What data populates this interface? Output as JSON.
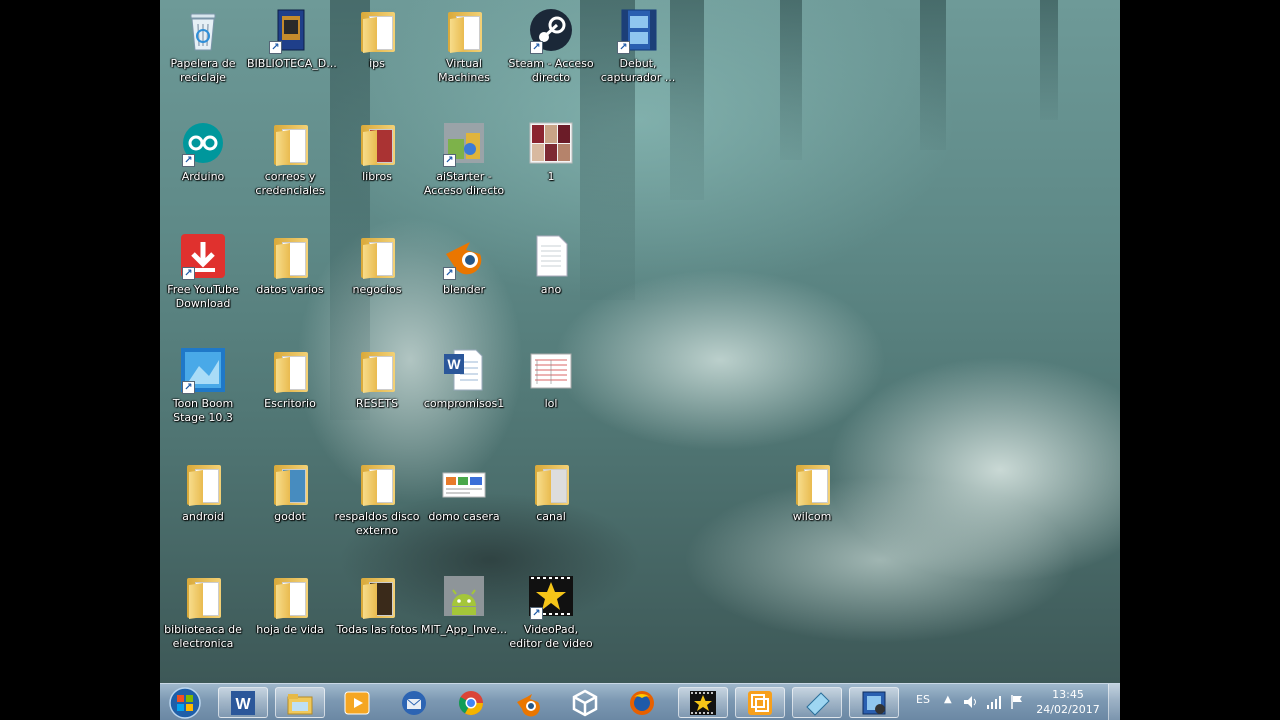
{
  "desktop": {
    "icons": [
      {
        "id": "recycle",
        "label": "Papelera de reciclaje"
      },
      {
        "id": "biblioteca",
        "label": "BIBLIOTECA_D..."
      },
      {
        "id": "ips",
        "label": "ips"
      },
      {
        "id": "vm",
        "label": "Virtual Machines"
      },
      {
        "id": "steam",
        "label": "Steam - Acceso directo"
      },
      {
        "id": "debut",
        "label": "Debut, capturador ..."
      },
      {
        "id": "arduino",
        "label": "Arduino"
      },
      {
        "id": "correos",
        "label": "correos y credenciales"
      },
      {
        "id": "libros",
        "label": "libros"
      },
      {
        "id": "aistarter",
        "label": "aiStarter - Acceso directo"
      },
      {
        "id": "one",
        "label": "1"
      },
      {
        "id": "fyd",
        "label": "Free YouTube Download"
      },
      {
        "id": "datos",
        "label": "datos varios"
      },
      {
        "id": "negocios",
        "label": "negocios"
      },
      {
        "id": "blender",
        "label": "blender"
      },
      {
        "id": "ano",
        "label": "ano"
      },
      {
        "id": "toonboom",
        "label": "Toon Boom Stage 10.3"
      },
      {
        "id": "escritorio",
        "label": "Escritorio"
      },
      {
        "id": "resets",
        "label": "RESETS"
      },
      {
        "id": "compromisos",
        "label": "compromisos1"
      },
      {
        "id": "lol",
        "label": "lol"
      },
      {
        "id": "android",
        "label": "android"
      },
      {
        "id": "godot",
        "label": "godot"
      },
      {
        "id": "respaldos",
        "label": "respaldos disco externo"
      },
      {
        "id": "domo",
        "label": "domo casera"
      },
      {
        "id": "canal",
        "label": "canal"
      },
      {
        "id": "wilcom",
        "label": "wilcom"
      },
      {
        "id": "bibelec",
        "label": "biblioteaca de electronica"
      },
      {
        "id": "hoja",
        "label": "hoja de vida"
      },
      {
        "id": "fotos",
        "label": "Todas las fotos"
      },
      {
        "id": "mit",
        "label": "MIT_App_Inve..."
      },
      {
        "id": "videopad",
        "label": "VideoPad, editor de video"
      }
    ]
  },
  "taskbar": {
    "apps": [
      {
        "name": "word-icon",
        "active": true
      },
      {
        "name": "file-explorer-icon",
        "active": true
      },
      {
        "name": "media-player-icon",
        "active": false
      },
      {
        "name": "thunderbird-icon",
        "active": false
      },
      {
        "name": "chrome-icon",
        "active": false
      },
      {
        "name": "blender-icon",
        "active": false
      },
      {
        "name": "unity-icon",
        "active": false
      },
      {
        "name": "firefox-icon",
        "active": false
      },
      {
        "name": "videopad-icon",
        "active": true
      },
      {
        "name": "vmware-icon",
        "active": true
      },
      {
        "name": "notepad-icon",
        "active": true
      },
      {
        "name": "debut-icon",
        "active": true
      }
    ],
    "tray": {
      "language": "ES",
      "time": "13:45",
      "date": "24/02/2017"
    }
  },
  "colors": {
    "taskbar": "#7c98b2",
    "folder": "#f0c95c",
    "wallpaper": "#5e8987"
  }
}
